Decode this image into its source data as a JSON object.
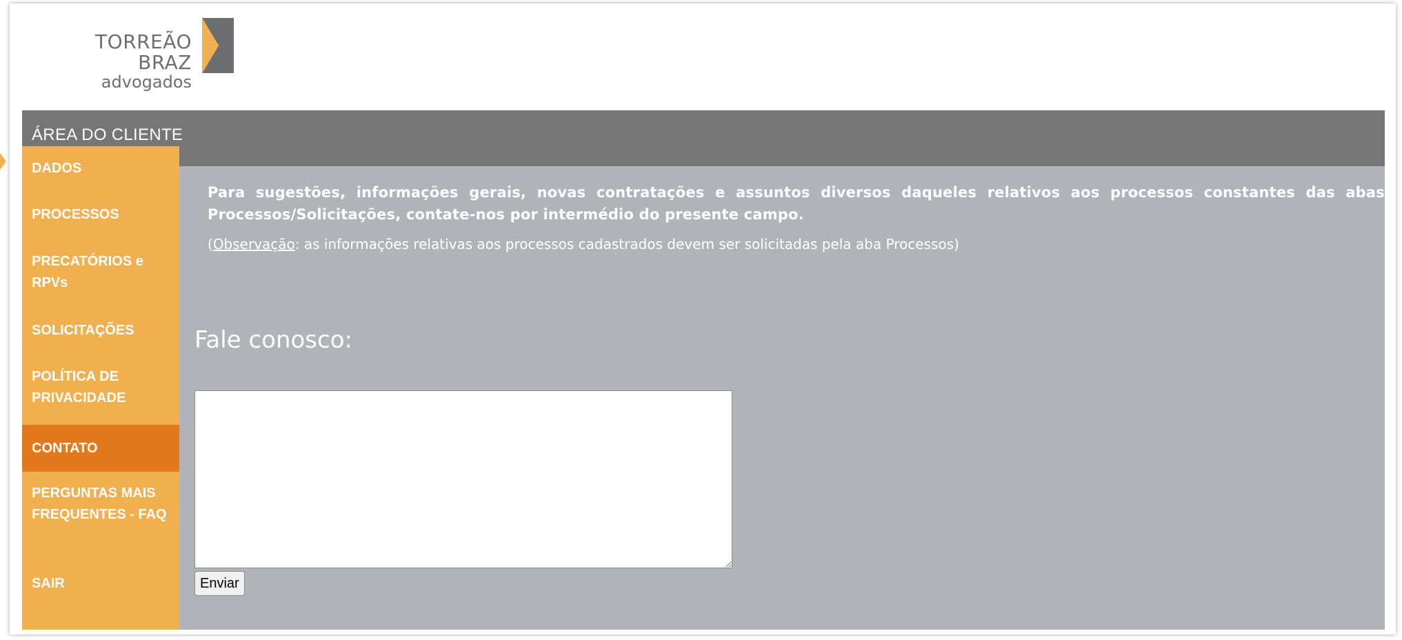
{
  "brand": {
    "name": "TORREÃO BRAZ",
    "subtitle": "advogados",
    "colors": {
      "gray": "#6d6e70",
      "gold": "#f0b050"
    }
  },
  "header": {
    "area_label": "ÁREA DO CLIENTE"
  },
  "sidebar": {
    "items": [
      {
        "label": "DADOS"
      },
      {
        "label": "PROCESSOS"
      },
      {
        "label": "PRECATÓRIOS e RPVs"
      },
      {
        "label": "SOLICITAÇÕES"
      },
      {
        "label": "POLÍTICA DE PRIVACIDADE"
      },
      {
        "label": "CONTATO",
        "active": true
      },
      {
        "label": "PERGUNTAS MAIS FREQUENTES - FAQ"
      },
      {
        "label": "SAIR"
      }
    ]
  },
  "main": {
    "intro": "Para sugestões, informações gerais, novas contratações e assuntos diversos daqueles relativos aos processos constantes das abas Processos/Solicitações, contate-nos por intermédio do presente campo.",
    "note_open": "(",
    "note_link": "Observação",
    "note_rest": ": as informações relativas aos processos cadastrados devem ser solicitadas pela aba Processos)",
    "form_title": "Fale conosco:",
    "message_value": "",
    "send_label": "Enviar"
  },
  "colors": {
    "topbar": "#767676",
    "sidebar": "#f0b050",
    "sidebar_active": "#e07a1c",
    "content": "#b0b3b7"
  }
}
